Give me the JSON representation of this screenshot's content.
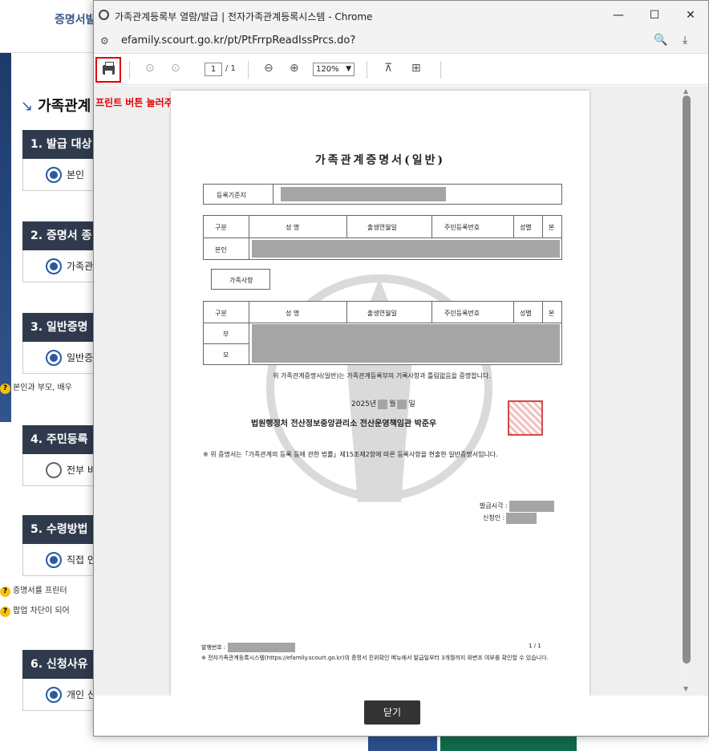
{
  "background": {
    "nav_label": "증명서발급",
    "page_title": "가족관계",
    "sections": [
      {
        "title": "1. 발급 대상",
        "option": "본인",
        "selected": true
      },
      {
        "title": "2. 증명서 종",
        "option": "가족관",
        "selected": true
      },
      {
        "title": "3. 일반증명",
        "option": "일반증",
        "selected": true
      },
      {
        "title": "4. 주민등록",
        "option": "전부 비",
        "selected": false
      },
      {
        "title": "5. 수령방법",
        "option": "직접 인",
        "selected": true
      },
      {
        "title": "6. 신청사유",
        "option": "개인 신",
        "selected": true
      }
    ],
    "hints": [
      "본인과 부모, 배우",
      "증명서를 프린터",
      "팝업 차단이 되어"
    ]
  },
  "window": {
    "title": "가족관계등록부 열람/발급 | 전자가족관계등록시스템 - Chrome",
    "url": "efamily.scourt.go.kr/pt/PtFrrpReadIssPrcs.do?",
    "minimize": "—",
    "maximize": "☐",
    "close": "✕"
  },
  "pdf_toolbar": {
    "page_current": "1",
    "page_total": "/ 1",
    "zoom": "120%"
  },
  "notice": "프린트 버튼 눌러주세요.",
  "document": {
    "title": "가족관계증명서(일반)",
    "registry_label": "등록기준지",
    "headers": [
      "구분",
      "성 명",
      "출생연월일",
      "주민등록번호",
      "성별",
      "본"
    ],
    "self_label": "본인",
    "family_section": "가족사항",
    "father_label": "부",
    "mother_label": "모",
    "cert_text": "위 가족관계증명서(일반)는 가족관계등록부의 기록사항과 틀림없음을 증명합니다.",
    "date_year": "2025년",
    "date_month": "월",
    "date_day": "일",
    "issuer": "법원행정처 전산정보중앙관리소 전산운영책임관 박준우",
    "note": "※ 위 증명서는「가족관계의 등록 등에 관한 법률」제15조제2항에 따른 등록사항을 현출한 일반증명서입니다.",
    "issued_at_label": "발급시각 :",
    "applicant_label": "신청인 :",
    "issue_no_label": "발행번호 :",
    "page_indicator": "1 / 1",
    "footer_note": "※ 전자가족관계등록시스템(https://efamily.scourt.go.kr)의 증명서 진위확인 메뉴에서 발급일부터 3개월까지 위변조 여부를 확인할 수 있습니다."
  },
  "close_button": "닫기"
}
